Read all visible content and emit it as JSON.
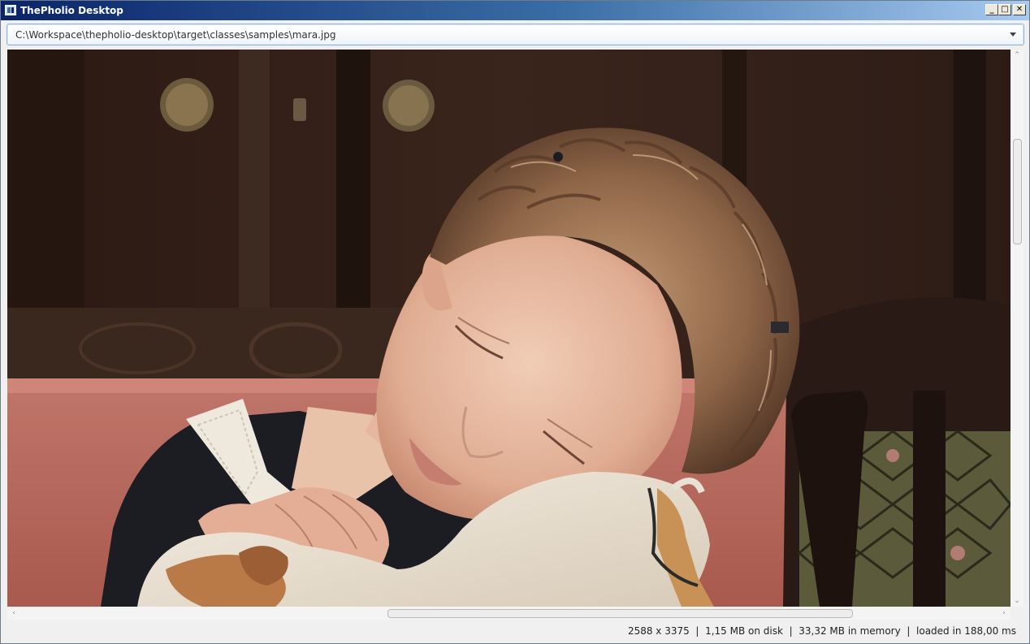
{
  "window": {
    "title": "ThePholio Desktop",
    "controls": {
      "minimize": "_",
      "maximize": "□",
      "close": "✕"
    }
  },
  "path_combo": {
    "value": "C:\\Workspace\\thepholio-desktop\\target\\classes\\samples\\mara.jpg",
    "arrow_icon": "chevron-down-icon"
  },
  "viewer": {
    "image_description_icon": "photo",
    "scroll_arrows": {
      "up": "⌃",
      "down": "⌄",
      "left": "‹",
      "right": "›"
    }
  },
  "status": {
    "dimensions": "2588 x 3375",
    "separator": "  |  ",
    "disk_size": "1,15 MB on disk",
    "memory_size": "33,32 MB in memory",
    "load_time": "loaded in 188,00 ms"
  },
  "colors": {
    "titlebar_start": "#0a246a",
    "titlebar_end": "#a6caf0",
    "combo_border": "#8fb6d8"
  }
}
